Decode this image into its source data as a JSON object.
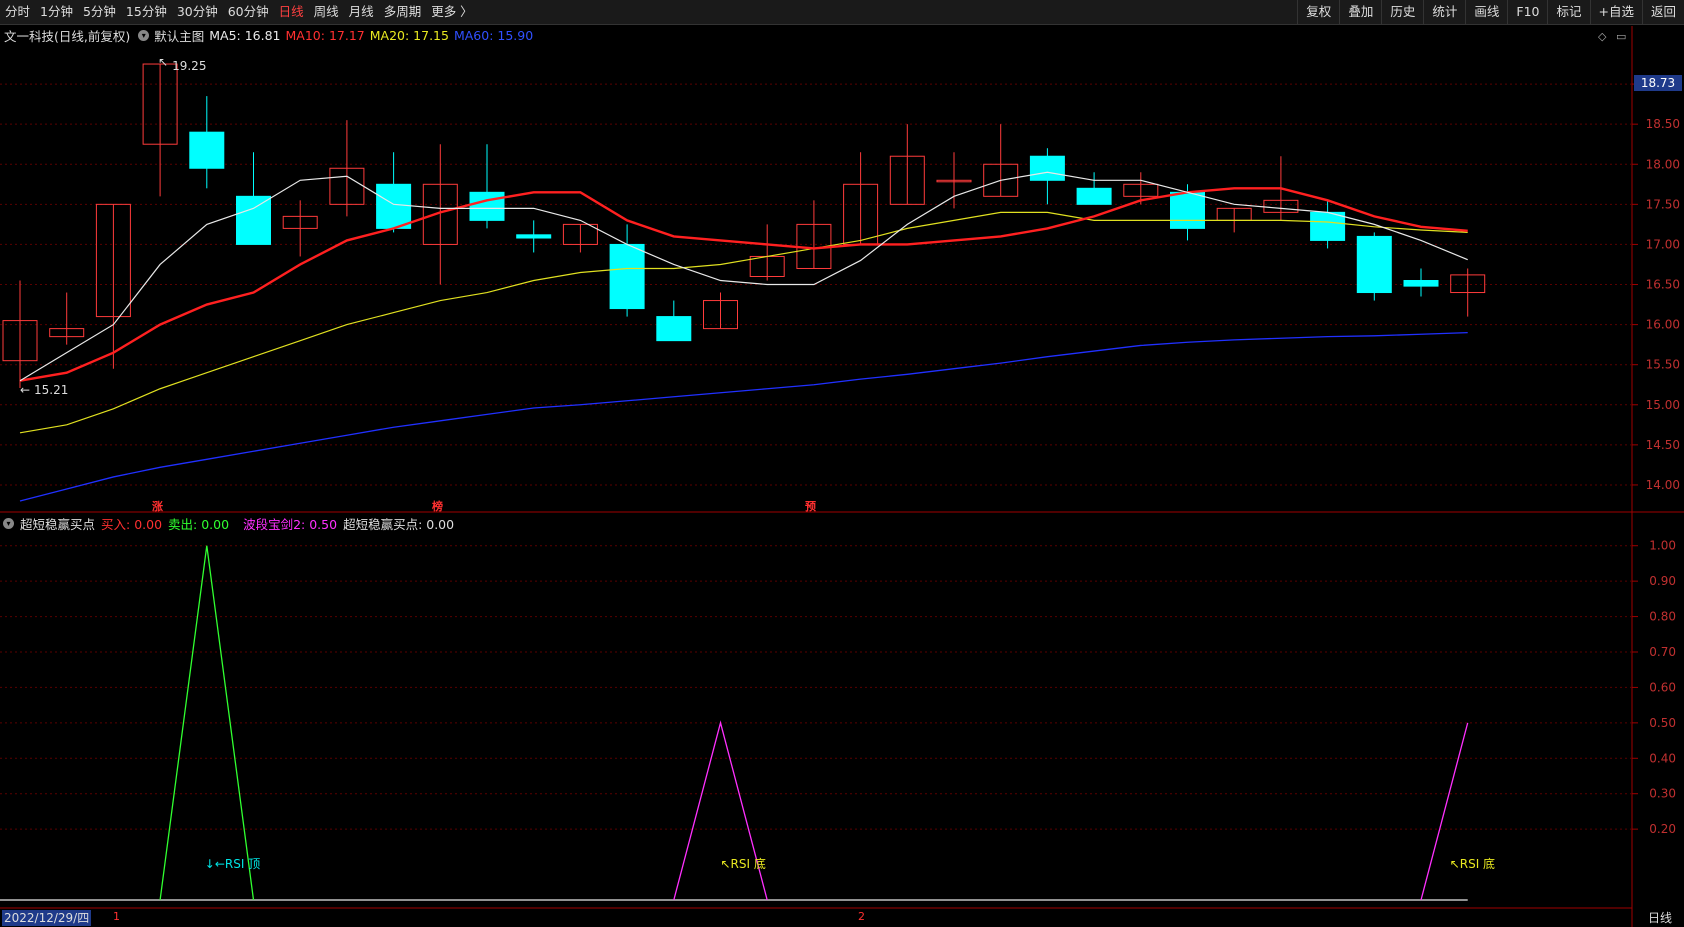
{
  "toolbar": {
    "periods": [
      "分时",
      "1分钟",
      "5分钟",
      "15分钟",
      "30分钟",
      "60分钟",
      "日线",
      "周线",
      "月线",
      "多周期",
      "更多 〉"
    ],
    "active_index": 6,
    "right_buttons": [
      "复权",
      "叠加",
      "历史",
      "统计",
      "画线",
      "F10",
      "标记",
      "+自选",
      "返回"
    ]
  },
  "info": {
    "stock": "文一科技(日线,前复权)",
    "template": "默认主图",
    "ma5": "MA5: 16.81",
    "ma10": "MA10: 17.17",
    "ma20": "MA20: 17.15",
    "ma60": "MA60: 15.90"
  },
  "sub_info": {
    "name": "超短稳赢买点",
    "buy": "买入: 0.00",
    "sell": "卖出: 0.00",
    "sword": "波段宝剑2: 0.50",
    "point": "超短稳赢买点: 0.00"
  },
  "markers": {
    "high": "19.25",
    "low": "15.21",
    "chips": [
      "涨",
      "榜",
      "预"
    ]
  },
  "current_price": "18.73",
  "main_axis_labels": [
    "19.00",
    "18.50",
    "18.00",
    "17.50",
    "17.00",
    "16.50",
    "16.00",
    "15.50",
    "15.00",
    "14.50",
    "14.00"
  ],
  "sub_axis_labels": [
    "1.00",
    "0.90",
    "0.80",
    "0.70",
    "0.60",
    "0.50",
    "0.40",
    "0.30",
    "0.20"
  ],
  "signals": {
    "top": "↓←RSI 顶",
    "bottom1": "↖RSI 底",
    "bottom2": "↖RSI 底"
  },
  "bottom": {
    "date": "2022/12/29/四",
    "m1": "1",
    "m2": "2",
    "period": "日线"
  },
  "colors": {
    "up": "#ff3b3b",
    "down": "#00ffff",
    "ma5": "#e8e8e8",
    "ma10": "#ff2020",
    "ma20": "#e0e020",
    "ma60": "#2030ff"
  },
  "chart_data": {
    "type": "candlestick",
    "y_range": [
      13.75,
      19.45
    ],
    "candles": [
      {
        "o": 15.55,
        "h": 16.55,
        "l": 15.21,
        "c": 16.05
      },
      {
        "o": 15.85,
        "h": 16.4,
        "l": 15.75,
        "c": 15.95
      },
      {
        "o": 16.1,
        "h": 17.5,
        "l": 15.45,
        "c": 17.5
      },
      {
        "o": 18.25,
        "h": 19.25,
        "l": 17.6,
        "c": 19.25
      },
      {
        "o": 18.4,
        "h": 18.85,
        "l": 17.7,
        "c": 17.95
      },
      {
        "o": 17.6,
        "h": 18.15,
        "l": 17.0,
        "c": 17.0
      },
      {
        "o": 17.2,
        "h": 17.55,
        "l": 16.85,
        "c": 17.35
      },
      {
        "o": 17.5,
        "h": 18.55,
        "l": 17.35,
        "c": 17.95
      },
      {
        "o": 17.75,
        "h": 18.15,
        "l": 17.15,
        "c": 17.2
      },
      {
        "o": 17.0,
        "h": 18.25,
        "l": 16.5,
        "c": 17.75
      },
      {
        "o": 17.65,
        "h": 18.25,
        "l": 17.2,
        "c": 17.3
      },
      {
        "o": 17.12,
        "h": 17.3,
        "l": 16.9,
        "c": 17.08
      },
      {
        "o": 17.0,
        "h": 17.25,
        "l": 16.9,
        "c": 17.25
      },
      {
        "o": 17.0,
        "h": 17.25,
        "l": 16.1,
        "c": 16.2
      },
      {
        "o": 16.1,
        "h": 16.3,
        "l": 15.8,
        "c": 15.8
      },
      {
        "o": 15.95,
        "h": 16.4,
        "l": 15.95,
        "c": 16.3
      },
      {
        "o": 16.6,
        "h": 17.25,
        "l": 16.55,
        "c": 16.85
      },
      {
        "o": 16.7,
        "h": 17.55,
        "l": 16.7,
        "c": 17.25
      },
      {
        "o": 17.0,
        "h": 18.15,
        "l": 17.0,
        "c": 17.75
      },
      {
        "o": 17.5,
        "h": 18.5,
        "l": 17.5,
        "c": 18.1
      },
      {
        "o": 17.8,
        "h": 18.15,
        "l": 17.45,
        "c": 17.8
      },
      {
        "o": 17.6,
        "h": 18.5,
        "l": 17.6,
        "c": 18.0
      },
      {
        "o": 18.1,
        "h": 18.2,
        "l": 17.5,
        "c": 17.8
      },
      {
        "o": 17.7,
        "h": 17.9,
        "l": 17.5,
        "c": 17.5
      },
      {
        "o": 17.6,
        "h": 17.9,
        "l": 17.5,
        "c": 17.75
      },
      {
        "o": 17.65,
        "h": 17.75,
        "l": 17.05,
        "c": 17.2
      },
      {
        "o": 17.3,
        "h": 17.45,
        "l": 17.15,
        "c": 17.45
      },
      {
        "o": 17.4,
        "h": 18.1,
        "l": 17.3,
        "c": 17.55
      },
      {
        "o": 17.4,
        "h": 17.55,
        "l": 16.95,
        "c": 17.05
      },
      {
        "o": 17.1,
        "h": 17.15,
        "l": 16.3,
        "c": 16.4
      },
      {
        "o": 16.55,
        "h": 16.7,
        "l": 16.35,
        "c": 16.48
      },
      {
        "o": 16.4,
        "h": 16.7,
        "l": 16.1,
        "c": 16.62
      }
    ],
    "ma5": [
      15.3,
      15.65,
      16.0,
      16.75,
      17.25,
      17.45,
      17.8,
      17.85,
      17.5,
      17.45,
      17.45,
      17.45,
      17.3,
      17.0,
      16.75,
      16.55,
      16.5,
      16.5,
      16.8,
      17.25,
      17.6,
      17.8,
      17.9,
      17.8,
      17.8,
      17.65,
      17.5,
      17.45,
      17.4,
      17.25,
      17.05,
      16.81
    ],
    "ma10": [
      15.3,
      15.4,
      15.65,
      16.0,
      16.25,
      16.4,
      16.75,
      17.05,
      17.2,
      17.4,
      17.55,
      17.65,
      17.65,
      17.3,
      17.1,
      17.05,
      17.0,
      16.95,
      17.0,
      17.0,
      17.05,
      17.1,
      17.2,
      17.35,
      17.55,
      17.65,
      17.7,
      17.7,
      17.55,
      17.35,
      17.22,
      17.17
    ],
    "ma20": [
      14.65,
      14.75,
      14.95,
      15.2,
      15.4,
      15.6,
      15.8,
      16.0,
      16.15,
      16.3,
      16.4,
      16.55,
      16.65,
      16.7,
      16.7,
      16.75,
      16.85,
      16.95,
      17.05,
      17.2,
      17.3,
      17.4,
      17.4,
      17.3,
      17.3,
      17.3,
      17.3,
      17.3,
      17.28,
      17.22,
      17.18,
      17.15
    ],
    "ma60": [
      13.8,
      13.95,
      14.1,
      14.22,
      14.32,
      14.42,
      14.52,
      14.62,
      14.72,
      14.8,
      14.88,
      14.96,
      15.0,
      15.05,
      15.1,
      15.15,
      15.2,
      15.25,
      15.32,
      15.38,
      15.45,
      15.52,
      15.6,
      15.67,
      15.74,
      15.78,
      15.81,
      15.83,
      15.85,
      15.86,
      15.88,
      15.9
    ],
    "sub_range": [
      0,
      1.05
    ],
    "sell_signal": [
      0,
      0,
      0,
      0,
      1,
      0,
      0,
      0,
      0,
      0,
      0,
      0,
      0,
      0,
      0,
      0,
      0,
      0,
      0,
      0,
      0,
      0,
      0,
      0,
      0,
      0,
      0,
      0,
      0,
      0,
      0,
      0
    ],
    "sword_signal": [
      0,
      0,
      0,
      0,
      0,
      0,
      0,
      0,
      0,
      0,
      0,
      0,
      0,
      0,
      0,
      0.5,
      0,
      0,
      0,
      0,
      0,
      0,
      0,
      0,
      0,
      0,
      0,
      0,
      0,
      0,
      0,
      0.5
    ]
  }
}
